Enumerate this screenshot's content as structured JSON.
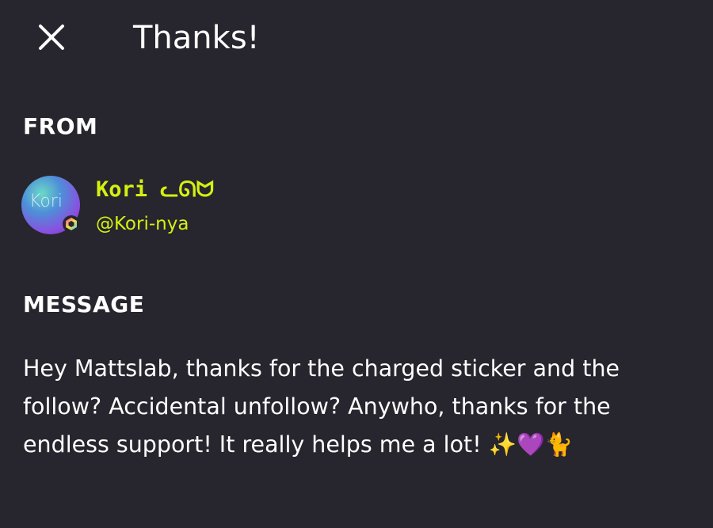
{
  "header": {
    "title": "Thanks!",
    "close_icon": "close-icon"
  },
  "from": {
    "label": "FROM",
    "display_name": "Kori ᓚᘏᗢ",
    "username": "@Kori-nya",
    "avatar_text": "Kori",
    "badge_icon": "hexagon-badge-icon"
  },
  "message": {
    "label": "MESSAGE",
    "text": "Hey Mattslab, thanks for the charged sticker and the follow? Accidental unfollow? Anywho, thanks for the endless support! It really helps me a lot! ✨💜🐈"
  },
  "colors": {
    "background": "#27252d",
    "accent": "#d4f013",
    "text": "#ffffff"
  }
}
